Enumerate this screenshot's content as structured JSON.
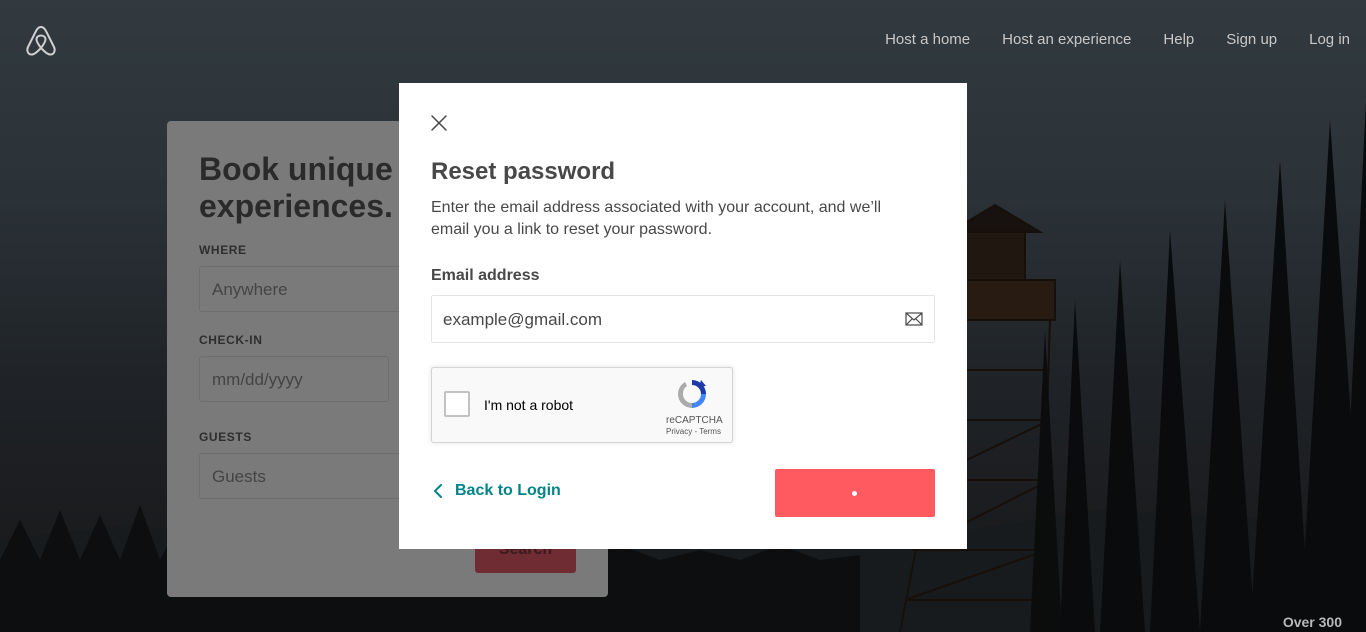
{
  "nav": {
    "items": [
      "Host a home",
      "Host an experience",
      "Help",
      "Sign up",
      "Log in"
    ]
  },
  "search_card": {
    "headline": "Book unique homes and experiences.",
    "where_label": "WHERE",
    "where_placeholder": "Anywhere",
    "checkin_label": "CHECK-IN",
    "checkin_placeholder": "mm/dd/yyyy",
    "guests_label": "GUESTS",
    "guests_placeholder": "Guests",
    "search_button": "Search"
  },
  "footer_text": "Over 300",
  "modal": {
    "title": "Reset password",
    "description": "Enter the email address associated with your account, and we’ll email you a link to reset your password.",
    "email_label": "Email address",
    "email_value": "example@gmail.com",
    "captcha": {
      "label": "I'm not a robot",
      "brand": "reCAPTCHA",
      "links": "Privacy - Terms"
    },
    "back_link": "Back to Login"
  },
  "colors": {
    "brand": "#ff5a5f",
    "link": "#008489",
    "text": "#484848"
  }
}
